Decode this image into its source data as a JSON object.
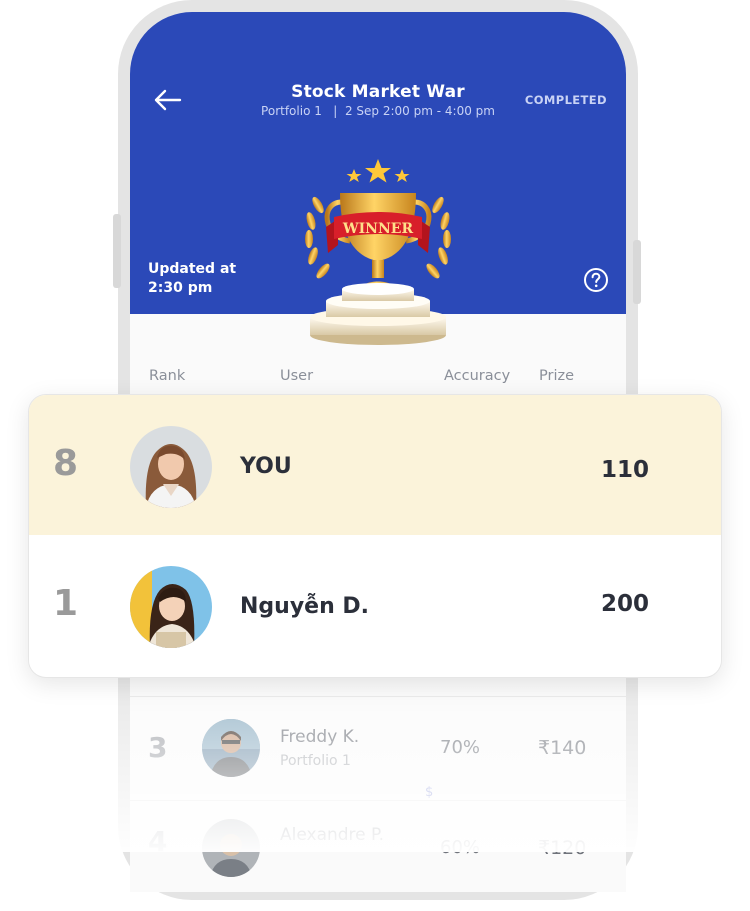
{
  "header": {
    "title": "Stock Market War",
    "subtitle": "Portfolio 1   |  2 Sep 2:00 pm - 4:00 pm",
    "status": "COMPLETED",
    "updated": "Updated at 2:30 pm",
    "trophy_banner": "WINNER",
    "back_icon": "arrow-left-icon",
    "help_icon": "question-circle-icon"
  },
  "columns": {
    "rank": "Rank",
    "user": "User",
    "accuracy": "Accuracy",
    "prize": "Prize"
  },
  "highlight_rows": [
    {
      "rank": "8",
      "name": "YOU",
      "prize": "110"
    },
    {
      "rank": "1",
      "name": "Nguyễn D.",
      "prize": "200"
    }
  ],
  "list_rows": [
    {
      "rank": "3",
      "name": "Freddy K.",
      "portfolio": "Portfolio 1",
      "accuracy": "70%",
      "prize": "₹140",
      "coin": "$"
    },
    {
      "rank": "4",
      "name": "Alexandre P.",
      "portfolio": "",
      "accuracy": "60%",
      "prize": "₹120"
    }
  ],
  "colors": {
    "brand_blue": "#2b49b8",
    "highlight_bg": "#fbf3da",
    "gold": "#f0b429"
  }
}
